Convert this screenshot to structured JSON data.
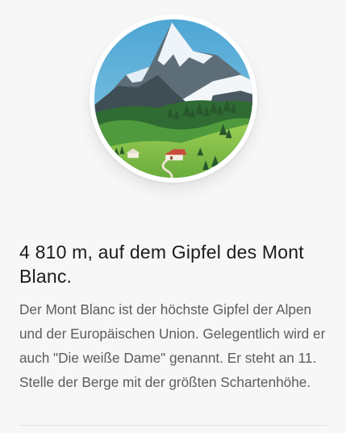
{
  "illustration": {
    "icon": "mountain-landscape-illustration",
    "colors": {
      "sky": "#4fa7d4",
      "snow": "#eef4f8",
      "rock": "#4b5a63",
      "forest": "#2f6b33",
      "meadow": "#86c14a",
      "roof": "#c94b3a"
    }
  },
  "card": {
    "title": "4 810 m, auf dem Gipfel des Mont Blanc.",
    "description": "Der Mont Blanc ist der höchste Gipfel der Alpen und der Europäischen Union. Gelegentlich wird er auch \"Die weiße Dame\" genannt. Er steht an 11. Stelle der Berge mit der größten Schartenhöhe."
  }
}
